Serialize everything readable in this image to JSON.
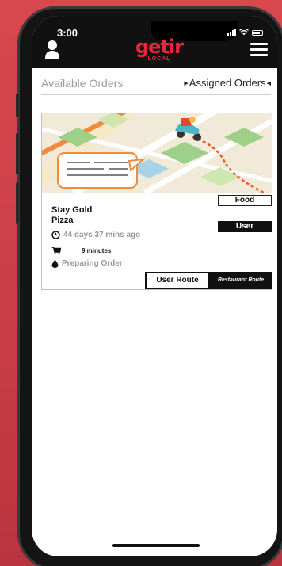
{
  "status_bar": {
    "time": "3:00"
  },
  "header": {
    "logo_main": "getir",
    "logo_sub": "LOCAL",
    "user_icon": "user-icon",
    "menu_icon": "hamburger-menu-icon"
  },
  "tabs": {
    "available": "Available Orders",
    "assigned": "Assigned Orders"
  },
  "order": {
    "store_line1": "Stay Gold",
    "store_line2": "Pizza",
    "category_badge": "Food",
    "role_badge": "User",
    "elapsed": "44 days 37 mins ago",
    "eta": "9 minutes",
    "status": "Preparing Order",
    "user_route_label": "User Route",
    "restaurant_route_label": "Restaurant Route"
  },
  "colors": {
    "brand_red": "#e8283a",
    "header_black": "#111111",
    "background_red": "#d9474f"
  }
}
